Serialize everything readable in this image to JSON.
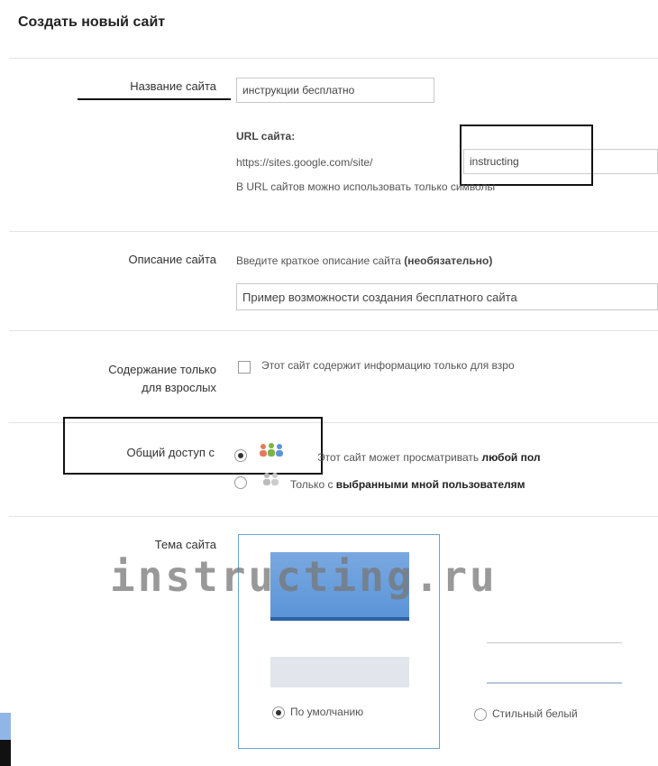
{
  "page": {
    "title": "Создать новый сайт"
  },
  "name": {
    "label": "Название сайта",
    "value": "инструкции бесплатно"
  },
  "url": {
    "heading": "URL сайта:",
    "prefix": "https://sites.google.com/site/",
    "value": "instructing",
    "hint": "В URL сайтов можно использовать только символы"
  },
  "description": {
    "label": "Описание сайта",
    "hint_plain": "Введите краткое описание сайта ",
    "hint_bold": "(необязательно)",
    "value": "Пример возможности создания бесплатного сайта"
  },
  "adult": {
    "label_line1": "Содержание только",
    "label_line2": "для взрослых",
    "checkbox_text": "Этот сайт содержит информацию только для взро",
    "checked": false
  },
  "sharing": {
    "label": "Общий доступ с",
    "option1_plain": "Этот сайт может просматривать ",
    "option1_bold": "любой пол",
    "option2_plain": "Только с ",
    "option2_bold": "выбранными мной пользователям",
    "selected": "option1",
    "icons": [
      "people-color-icon",
      "people-gray-icon"
    ]
  },
  "theme": {
    "label": "Тема сайта",
    "option1": "По умолчанию",
    "option2": "Стильный белый",
    "selected": "option1"
  },
  "watermark": "instructing.ru",
  "colors": {
    "accent_blue": "#5b95d8",
    "annotation_black": "#111111"
  }
}
